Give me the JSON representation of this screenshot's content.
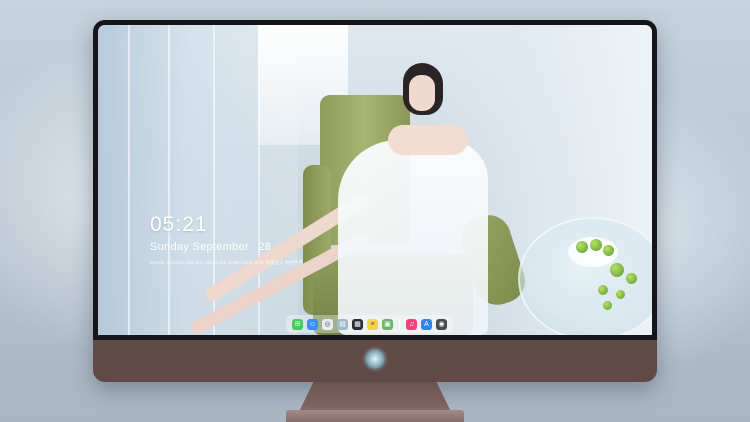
{
  "lock_screen": {
    "time": "05:21",
    "date_weekday_month": "Sunday September",
    "date_day": "28",
    "quote": "Breeze, sunshine and sea, yield to the gentle touch of life 浪漫主义  你好世界"
  },
  "dock": {
    "icons": [
      {
        "name": "messages-icon",
        "color": "#3ecf5a",
        "glyph": "✉"
      },
      {
        "name": "finder-icon",
        "color": "#3b8ff0",
        "glyph": "☺"
      },
      {
        "name": "safari-icon",
        "color": "#e6eef5",
        "glyph": "◎"
      },
      {
        "name": "preview-icon",
        "color": "#9fb7c9",
        "glyph": "▤"
      },
      {
        "name": "clapper-icon",
        "color": "#2c2c30",
        "glyph": "▦"
      },
      {
        "name": "notes-icon",
        "color": "#f6d24a",
        "glyph": "≡"
      },
      {
        "name": "photos-icon",
        "color": "#67b86a",
        "glyph": "▣"
      },
      {
        "name": "music-icon",
        "color": "#f0427a",
        "glyph": "♫"
      },
      {
        "name": "appstore-icon",
        "color": "#2f86e8",
        "glyph": "A"
      },
      {
        "name": "camera-icon",
        "color": "#4a4a4f",
        "glyph": "◉"
      }
    ]
  },
  "colors": {
    "bezel": "#16161a",
    "chassis": "#6d5350",
    "clock_text": "#ffffff"
  }
}
